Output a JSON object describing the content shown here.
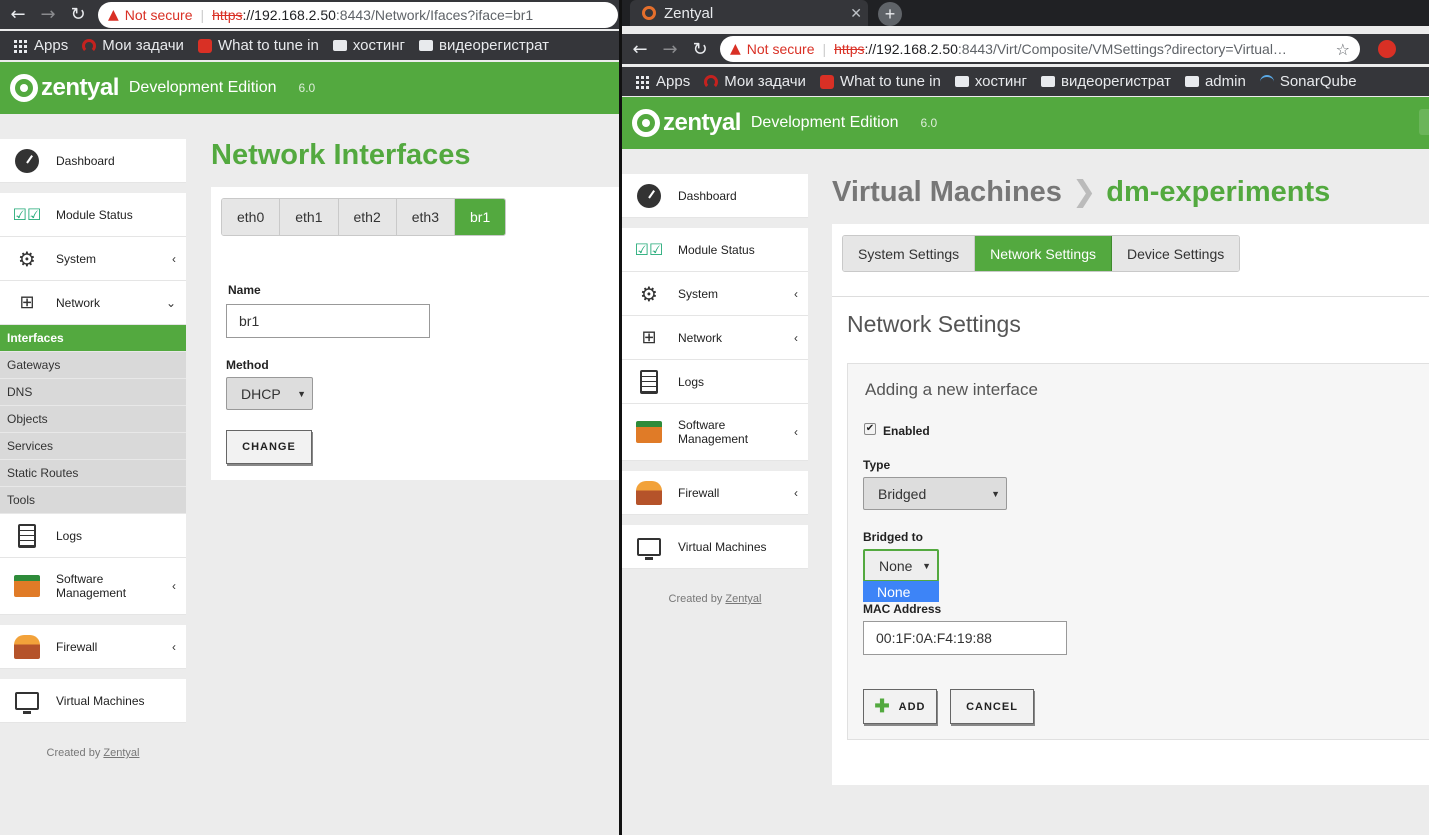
{
  "left": {
    "address": {
      "warning": "Not secure",
      "https": "https",
      "host": "://192.168.2.50",
      "path": ":8443/Network/Ifaces?iface=br1"
    },
    "bookmarks": [
      "Apps",
      "Мои задачи",
      "What to tune in",
      "хостинг",
      "видеорегистрат"
    ],
    "header": {
      "brand": "zentyal",
      "edition": "Development Edition",
      "version": "6.0"
    },
    "sidebar": {
      "items": [
        "Dashboard",
        "Module Status",
        "System",
        "Network"
      ],
      "network_sub": [
        "Interfaces",
        "Gateways",
        "DNS",
        "Objects",
        "Services",
        "Static Routes",
        "Tools"
      ],
      "items2": [
        "Logs",
        "Software Management",
        "Firewall",
        "Virtual Machines"
      ],
      "credit": "Created by",
      "credit_link": "Zentyal"
    },
    "page": {
      "title": "Network Interfaces",
      "tabs": [
        "eth0",
        "eth1",
        "eth2",
        "eth3",
        "br1"
      ],
      "name_label": "Name",
      "name_value": "br1",
      "method_label": "Method",
      "method_value": "DHCP",
      "change_button": "CHANGE"
    }
  },
  "right": {
    "tab_title": "Zentyal",
    "address": {
      "warning": "Not secure",
      "https": "https",
      "host": "://192.168.2.50",
      "path": ":8443/Virt/Composite/VMSettings?directory=Virtual…"
    },
    "bookmarks": [
      "Apps",
      "Мои задачи",
      "What to tune in",
      "хостинг",
      "видеорегистрат",
      "admin",
      "SonarQube"
    ],
    "header": {
      "brand": "zentyal",
      "edition": "Development Edition",
      "version": "6.0"
    },
    "sidebar": {
      "items": [
        "Dashboard",
        "Module Status",
        "System",
        "Network",
        "Logs",
        "Software Management",
        "Firewall",
        "Virtual Machines"
      ],
      "credit": "Created by",
      "credit_link": "Zentyal"
    },
    "page": {
      "crumb_parent": "Virtual Machines",
      "crumb_sep": "❯",
      "crumb_current": "dm-experiments",
      "tabs": [
        "System Settings",
        "Network Settings",
        "Device Settings"
      ],
      "section_title": "Network Settings",
      "form_title": "Adding a new interface",
      "enabled_label": "Enabled",
      "type_label": "Type",
      "type_value": "Bridged",
      "bridged_label": "Bridged to",
      "bridged_value": "None",
      "bridged_options": [
        "None"
      ],
      "mac_label": "MAC Address",
      "mac_value": "00:1F:0A:F4:19:88",
      "add_button": "ADD",
      "cancel_button": "CANCEL"
    }
  },
  "colors": {
    "accent": "#53a93f",
    "chrome": "#35363a",
    "warning": "#d93025"
  }
}
